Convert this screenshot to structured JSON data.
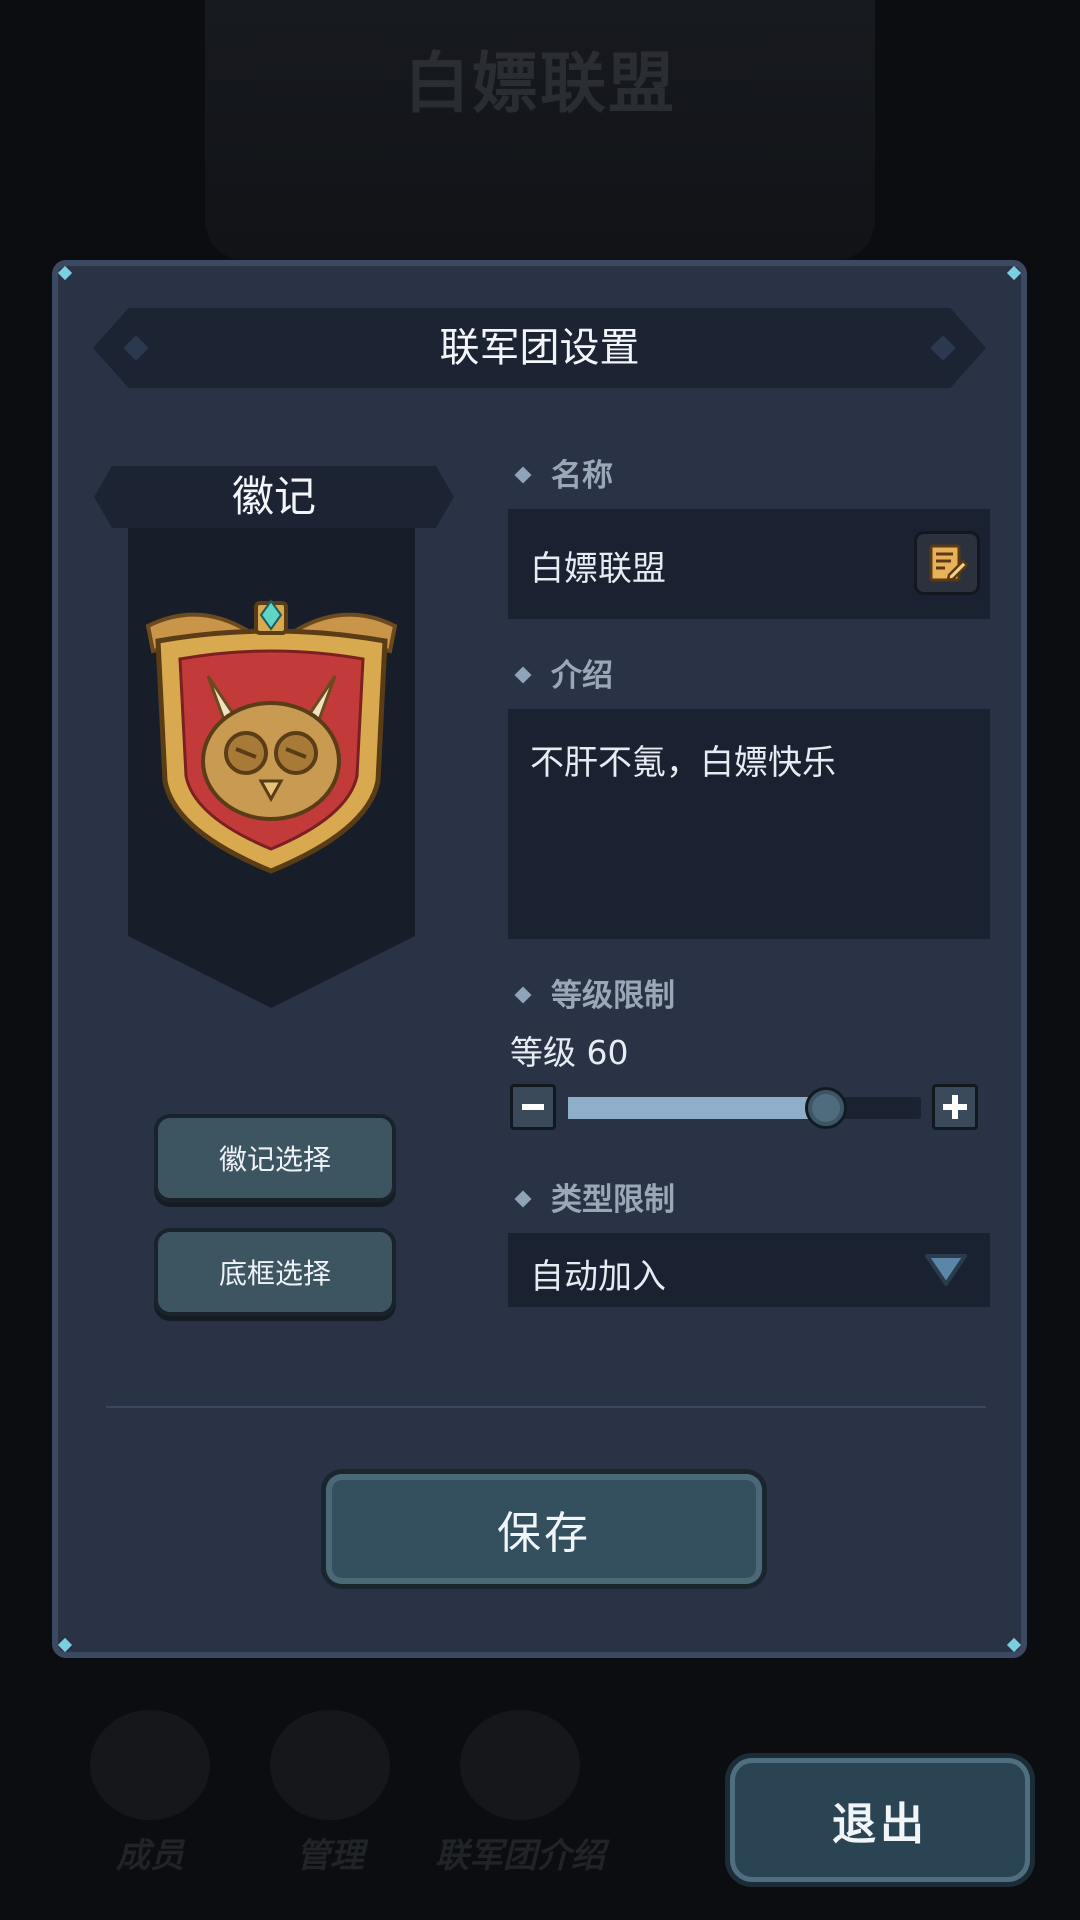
{
  "background": {
    "title": "白嫖联盟",
    "tabs": [
      {
        "label": "成员"
      },
      {
        "label": "管理"
      },
      {
        "label": "联军团介绍"
      }
    ],
    "exit_label": "退出"
  },
  "dialog": {
    "title": "联军团设置",
    "emblem": {
      "heading": "徽记",
      "emblem_select_label": "徽记选择",
      "frame_select_label": "底框选择"
    },
    "name": {
      "label": "名称",
      "value": "白嫖联盟",
      "edit_icon": "edit-note-icon"
    },
    "intro": {
      "label": "介绍",
      "value": "不肝不氪，白嫖快乐"
    },
    "level": {
      "label": "等级限制",
      "value_text": "等级 60",
      "slider_fraction": 0.73
    },
    "type": {
      "label": "类型限制",
      "selected": "自动加入"
    },
    "save_label": "保存"
  },
  "colors": {
    "dialog_bg": "#2a3346",
    "panel_dark": "#1a2130",
    "slider_fill": "#8eaec9",
    "button_teal": "#34505f"
  }
}
